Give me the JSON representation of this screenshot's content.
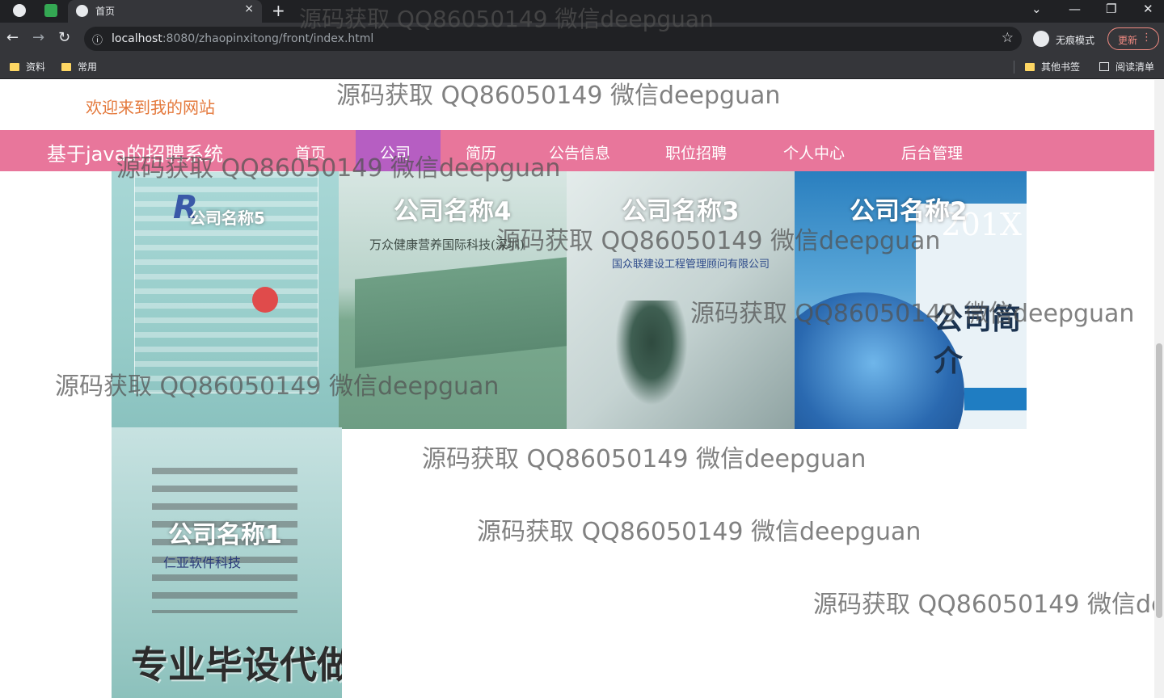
{
  "browser": {
    "tab_title": "首页",
    "tab_close": "×",
    "new_tab": "+",
    "url_host": "localhost",
    "url_rest": ":8080/zhaopinxitong/front/index.html",
    "incognito_label": "无痕模式",
    "update_label": "更新",
    "window_controls": [
      "⌄",
      "—",
      "❐",
      "✕"
    ],
    "nav_icons": [
      "back-arrow-icon",
      "forward-arrow-icon",
      "reload-icon"
    ],
    "bookmarks_left": [
      "资料",
      "常用"
    ],
    "bookmarks_right": [
      "其他书签",
      "阅读清单"
    ]
  },
  "header": {
    "welcome": "欢迎来到我的网站",
    "brand": "基于java的招聘系统"
  },
  "nav": {
    "items": [
      "首页",
      "公司",
      "简历",
      "公告信息",
      "职位招聘",
      "个人中心",
      "后台管理"
    ],
    "active_index": 1,
    "active_color": "#b65ec2",
    "bar_color": "#e8769b"
  },
  "companies": [
    {
      "name": "公司名称5"
    },
    {
      "name": "公司名称4",
      "sign": "万众健康营养国际科技(深圳)"
    },
    {
      "name": "公司名称3",
      "sign": "国众联建设工程管理顾问有限公司"
    },
    {
      "name": "公司名称2",
      "year": "201X",
      "intro": "公司简介"
    },
    {
      "name": "公司名称1",
      "sign": "仁亚软件科技",
      "promo": "专业毕设代做"
    }
  ],
  "watermark": "源码获取 QQ86050149 微信deepguan"
}
